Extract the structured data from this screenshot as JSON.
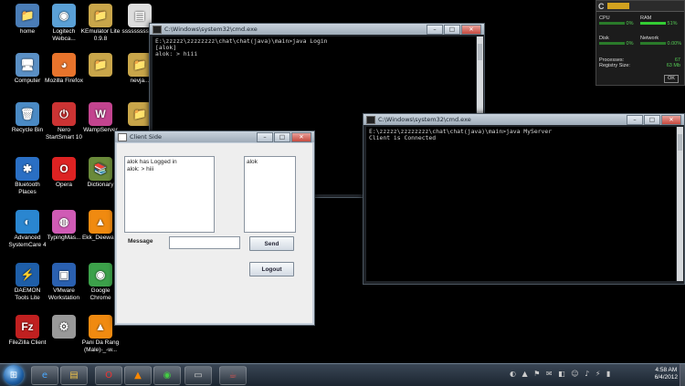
{
  "desktop_icons": [
    {
      "label": "home",
      "glyph": "📁"
    },
    {
      "label": "Logitech Webca...",
      "glyph": "◉"
    },
    {
      "label": "KEmulator Lite 0.9.8",
      "glyph": "📁"
    },
    {
      "label": "ssssssssssss",
      "glyph": "▤"
    },
    {
      "label": "Computer",
      "glyph": "🖥"
    },
    {
      "label": "Mozilla Firefox",
      "glyph": "◕"
    },
    {
      "label": "",
      "glyph": "📁"
    },
    {
      "label": "nevja...",
      "glyph": "📁"
    },
    {
      "label": "Recycle Bin",
      "glyph": "🗑"
    },
    {
      "label": "Nero StartSmart 10",
      "glyph": "⏻"
    },
    {
      "label": "WampServer",
      "glyph": "W"
    },
    {
      "label": "",
      "glyph": "📁"
    },
    {
      "label": "Bluetooth Places",
      "glyph": "✱"
    },
    {
      "label": "Opera",
      "glyph": "O"
    },
    {
      "label": "Dictionary",
      "glyph": "📚"
    },
    {
      "label": "Advanced SystemCare 4",
      "glyph": "◐"
    },
    {
      "label": "TypingMas...",
      "glyph": "◍"
    },
    {
      "label": "Ekk_Deewa...",
      "glyph": "▲"
    },
    {
      "label": "DAEMON Tools Lite",
      "glyph": "⚡"
    },
    {
      "label": "VMware Workstation",
      "glyph": "▣"
    },
    {
      "label": "Google Chrome",
      "glyph": "◉"
    },
    {
      "label": "FileZilla Client",
      "glyph": "Fz"
    },
    {
      "label": "",
      "glyph": "⚙"
    },
    {
      "label": "Pani Da Rang (Male)-_-w...",
      "glyph": "▲"
    }
  ],
  "login_console": {
    "title": "C:\\Windows\\system32\\cmd.exe",
    "text": "E:\\zzzzz\\zzzzzzzz\\chat\\chat(java)\\main>java Login\n[alok]\nalok: > hiii"
  },
  "server_console": {
    "title": "C:\\Windows\\system32\\cmd.exe",
    "text": "E:\\zzzzz\\zzzzzzzz\\chat\\chat(java)\\main>java MyServer\nClient is Connected"
  },
  "client_window": {
    "title": "Client Side",
    "chat_lines": [
      "alok has Logged in",
      "alok: > hiii"
    ],
    "users": [
      "alok"
    ],
    "message_label": "Message",
    "message_value": "",
    "send_label": "Send",
    "logout_label": "Logout"
  },
  "gadget": {
    "cpu_label": "CPU",
    "cpu_value": "0%",
    "ram_label": "RAM",
    "ram_value": "51%",
    "disk_label": "Disk",
    "disk_value": "0%",
    "network_label": "Network",
    "network_value": "0.00%",
    "processes_label": "Processes:",
    "processes_value": "67",
    "registry_label": "Registry Size:",
    "registry_value": "63 Mb",
    "ok_label": "OK"
  },
  "taskbar": {
    "time": "4:58 AM",
    "date": "6/4/2012"
  }
}
